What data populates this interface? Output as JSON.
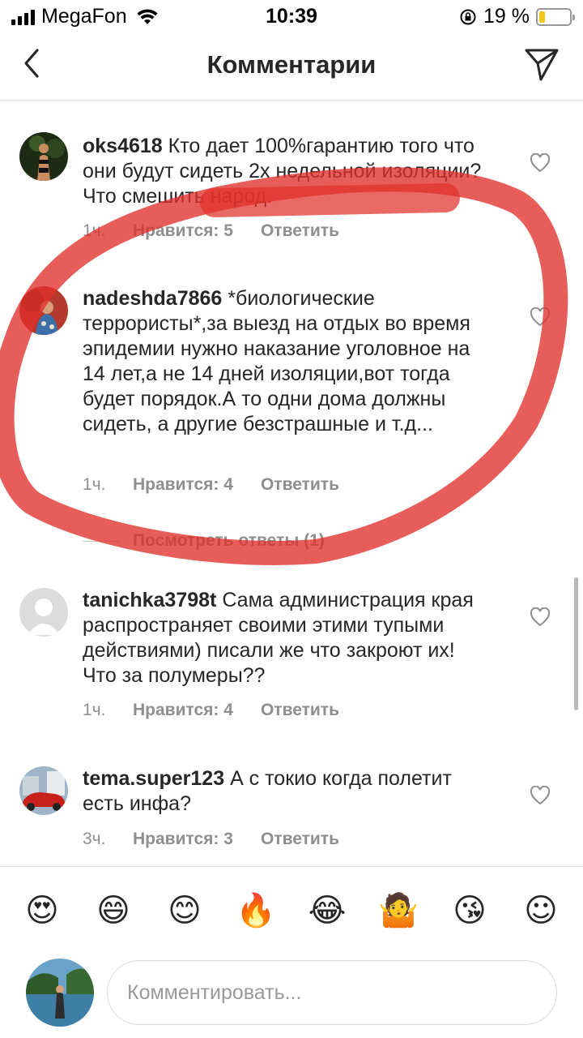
{
  "status_bar": {
    "carrier": "MegaFon",
    "time": "10:39",
    "battery_text": "19 %",
    "battery_level": 0.19,
    "battery_color": "#f5c518"
  },
  "nav": {
    "back_icon": "chevron-left-icon",
    "title": "Комментарии",
    "send_icon": "paper-plane-icon"
  },
  "comments": [
    {
      "username": "oks4618",
      "text": "Кто дает 100%гарантию того что они будут сидеть 2х недельной изоляции? Что смешить народ.",
      "time": "1ч.",
      "likes": "Нравится: 5",
      "reply": "Ответить"
    },
    {
      "username": "nadeshda7866",
      "text": "*биологические террористы*,за выезд на отдых во время эпидемии нужно наказание уголовное на 14 лет,а не 14 дней изоляции,вот тогда будет порядок.А то одни дома должны сидеть, а другие безстрашные и т.д...",
      "time": "1ч.",
      "likes": "Нравится: 4",
      "reply": "Ответить",
      "view_replies": "Посмотреть ответы (1)"
    },
    {
      "username": "tanichka3798t",
      "text": "Сама администрация края распространяет своими этими тупыми действиями) писали же что закроют их! Что за полумеры??",
      "time": "1ч.",
      "likes": "Нравится: 4",
      "reply": "Ответить"
    },
    {
      "username": "tema.super123",
      "text": "А с токио когда полетит есть инфа?",
      "time": "3ч.",
      "likes": "Нравится: 3",
      "reply": "Ответить"
    }
  ],
  "emoji_bar": [
    "😍",
    "😄",
    "😊",
    "🔥",
    "😂",
    "🤷",
    "😘",
    "☺"
  ],
  "composer": {
    "placeholder": "Комментировать..."
  },
  "annotation_color": "#e0302a"
}
